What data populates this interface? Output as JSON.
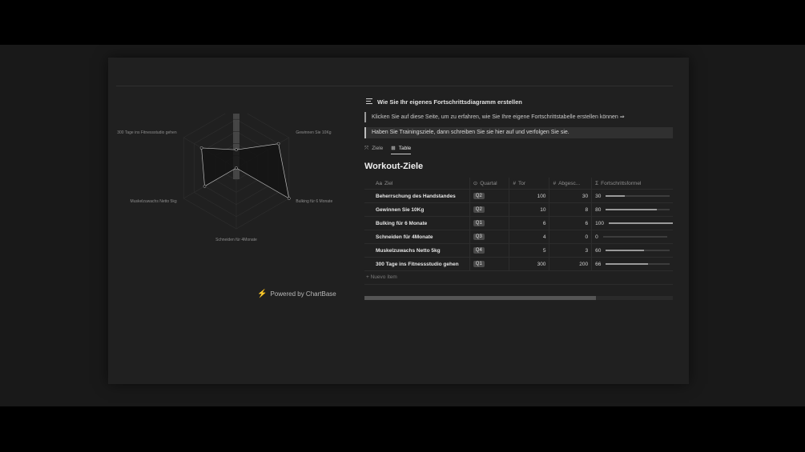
{
  "radar": {
    "axes": [
      {
        "label": "Beherrschung des Handstandes",
        "value": 0.3
      },
      {
        "label": "Gewinnen Sie 10Kg",
        "value": 0.8
      },
      {
        "label": "Bulking für 6 Monate",
        "value": 1.0
      },
      {
        "label": "Schneiden für 4Monate",
        "value": 0.0
      },
      {
        "label": "Muskelzuwachs Netto 5kg",
        "value": 0.6
      },
      {
        "label": "300 Tage ins Fitnessstudio gehen",
        "value": 0.66
      }
    ],
    "powered_by": "Powered by ChartBase",
    "colors": {
      "fill": "#111111",
      "stroke": "#bbbbbb",
      "grid": "#2f2f2f"
    }
  },
  "callout": {
    "title": "Wie Sie Ihr eigenes Fortschrittsdiagramm erstellen",
    "link_text": "Klicken Sie auf diese Seite, um zu erfahren, wie Sie Ihre eigene Fortschrittstabelle erstellen können ⇒",
    "highlight_text": "Haben Sie Trainingsziele, dann schreiben Sie sie hier auf und verfolgen Sie sie."
  },
  "tabs": [
    {
      "label": "Ziele",
      "icon": "target-icon",
      "active": false
    },
    {
      "label": "Table",
      "icon": "table-icon",
      "active": true
    }
  ],
  "database": {
    "title": "Workout-Ziele",
    "columns": {
      "name": "Ziel",
      "name_icon": "Aa",
      "quarter": "Quartal",
      "tor": "Tor",
      "abges": "Abgesc...",
      "formula": "Fortschrittsformel",
      "number_icon": "#",
      "formula_icon": "Σ"
    },
    "rows": [
      {
        "name": "Beherrschung des Handstandes",
        "quarter": "Q2",
        "tor": "100",
        "abges": "30",
        "progress": "30",
        "fraction": 0.3
      },
      {
        "name": "Gewinnen Sie 10Kg",
        "quarter": "Q2",
        "tor": "10",
        "abges": "8",
        "progress": "80",
        "fraction": 0.8
      },
      {
        "name": "Bulking für 6 Monate",
        "quarter": "Q1",
        "tor": "6",
        "abges": "6",
        "progress": "100",
        "fraction": 1.0
      },
      {
        "name": "Schneiden für 4Monate",
        "quarter": "Q3",
        "tor": "4",
        "abges": "0",
        "progress": "0",
        "fraction": 0.0
      },
      {
        "name": "Muskelzuwachs Netto 5kg",
        "quarter": "Q4",
        "tor": "5",
        "abges": "3",
        "progress": "60",
        "fraction": 0.6
      },
      {
        "name": "300 Tage ins Fitnessstudio gehen",
        "quarter": "Q1",
        "tor": "300",
        "abges": "200",
        "progress": "66",
        "fraction": 0.66
      }
    ],
    "new_item": "+ Nuevo ítem",
    "scroll_fraction": 0.75
  }
}
